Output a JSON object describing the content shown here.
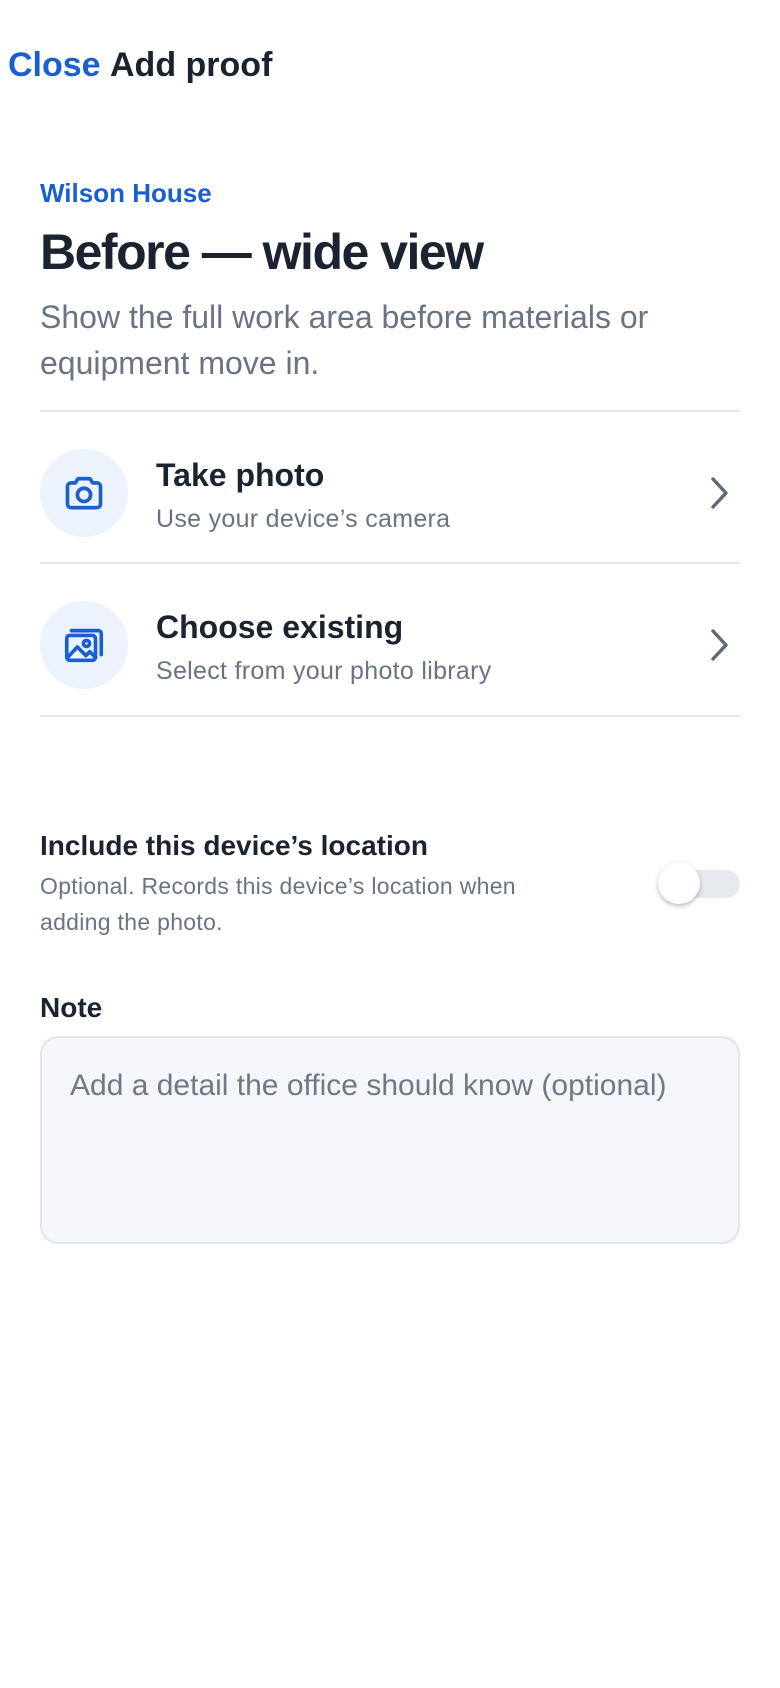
{
  "header": {
    "close_label": "Close",
    "title": "Add proof"
  },
  "intro": {
    "project": "Wilson House",
    "step_title": "Before — wide view",
    "description": "Show the full work area before materials or equipment move in."
  },
  "options": [
    {
      "icon": "camera-icon",
      "title": "Take photo",
      "subtitle": "Use your device’s camera"
    },
    {
      "icon": "photo-library-icon",
      "title": "Choose existing",
      "subtitle": "Select from your photo library"
    }
  ],
  "location": {
    "title": "Include this device’s location",
    "description": "Optional. Records this device’s location when adding the photo.",
    "enabled": false
  },
  "note": {
    "label": "Note",
    "value": "",
    "placeholder": "Add a detail the office should know (optional)"
  },
  "colors": {
    "accent": "#1a5fd0",
    "text_primary": "#1b2330",
    "text_secondary": "#697384",
    "icon_bg": "#edf3fc",
    "divider": "#e4e6ea",
    "field_bg": "#f4f6fa"
  }
}
